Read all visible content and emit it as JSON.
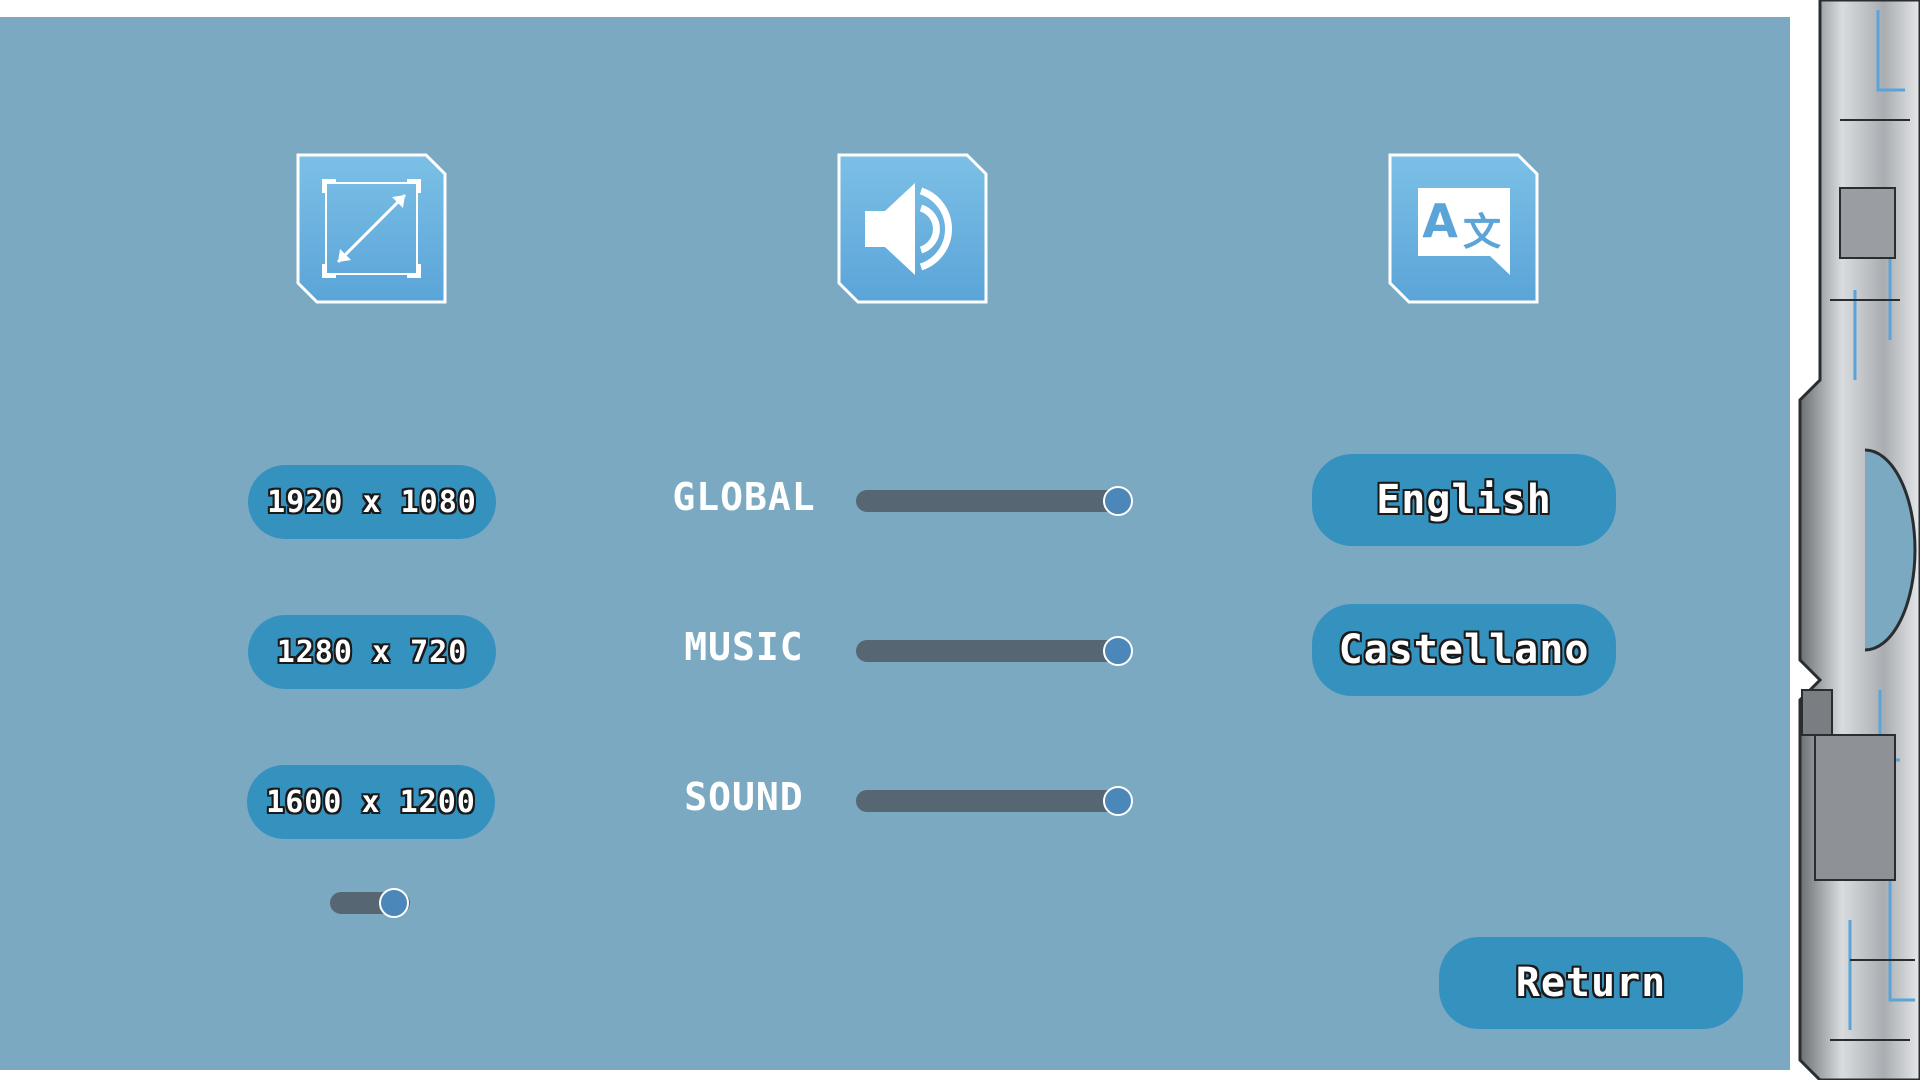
{
  "colors": {
    "panel_bg": "#7ba9c2",
    "button_bg": "#3592bf",
    "icon_tile_top": "#7cc0e6",
    "icon_tile_bottom": "#5aa4d8",
    "slider_track": "#566672",
    "slider_knob": "#4b87b8"
  },
  "icons": {
    "display": "resize-arrows-icon",
    "audio": "speaker-icon",
    "language": "translate-icon"
  },
  "display": {
    "resolutions": [
      "1920 x 1080",
      "1280 x 720",
      "1600 x 1200"
    ],
    "fullscreen_toggle_value": 0.8
  },
  "audio": {
    "channels": [
      {
        "label": "GLOBAL",
        "level": 1.0
      },
      {
        "label": "MUSIC",
        "level": 1.0
      },
      {
        "label": "SOUND",
        "level": 1.0
      }
    ]
  },
  "language": {
    "options": [
      "English",
      "Castellano"
    ]
  },
  "return_label": "Return"
}
